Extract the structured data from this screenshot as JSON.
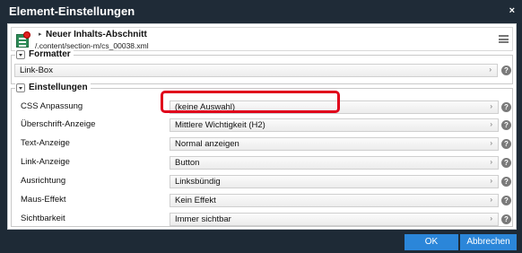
{
  "dialog": {
    "title": "Element-Einstellungen",
    "close_label": "×"
  },
  "element_header": {
    "arrow": "▸",
    "name": "Neuer Inhalts-Abschnitt",
    "path": "/.content/section-m/cs_00038.xml",
    "icon": "content-section-icon"
  },
  "formatter": {
    "legend": "Formatter",
    "value": "Link-Box"
  },
  "settings": {
    "legend": "Einstellungen",
    "rows": [
      {
        "label": "CSS Anpassung",
        "value": "(keine Auswahl)"
      },
      {
        "label": "Überschrift-Anzeige",
        "value": "Mittlere Wichtigkeit (H2)"
      },
      {
        "label": "Text-Anzeige",
        "value": "Normal anzeigen"
      },
      {
        "label": "Link-Anzeige",
        "value": "Button"
      },
      {
        "label": "Ausrichtung",
        "value": "Linksbündig"
      },
      {
        "label": "Maus-Effekt",
        "value": "Kein Effekt"
      },
      {
        "label": "Sichtbarkeit",
        "value": "Immer sichtbar"
      }
    ]
  },
  "ui": {
    "help_glyph": "?",
    "caret_glyph": "›",
    "highlight_color": "#e0001b",
    "accent_color": "#2b86d9"
  },
  "buttons": {
    "ok": "OK",
    "cancel": "Abbrechen"
  }
}
